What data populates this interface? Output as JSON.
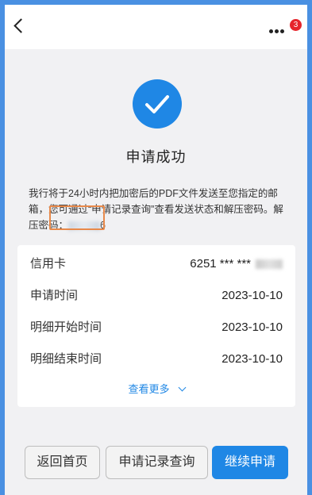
{
  "header": {
    "notification_count": "3"
  },
  "result": {
    "title": "申请成功",
    "message_main": "我行将于24小时内把加密后的PDF文件发送至您指定的邮箱，您可通过“申请记录查询”查看发送状态和解压密码。解压密码：",
    "password_visible_tail": "6"
  },
  "details": {
    "rows": [
      {
        "label": "信用卡",
        "value": "6251 *** ***"
      },
      {
        "label": "申请时间",
        "value": "2023-10-10"
      },
      {
        "label": "明细开始时间",
        "value": "2023-10-10"
      },
      {
        "label": "明细结束时间",
        "value": "2023-10-10"
      }
    ],
    "more_label": "查看更多"
  },
  "actions": {
    "home": "返回首页",
    "records": "申请记录查询",
    "continue": "继续申请"
  },
  "colors": {
    "accent": "#1f87e5",
    "frame": "#4a90e2",
    "badge": "#e6242b",
    "highlight": "#e8894a"
  }
}
